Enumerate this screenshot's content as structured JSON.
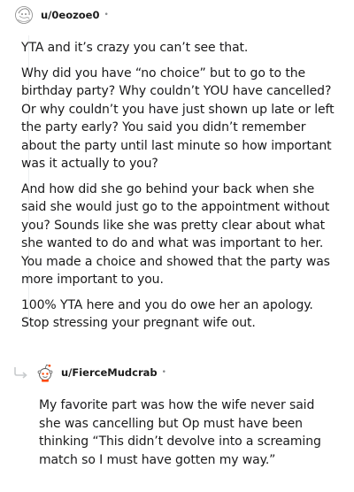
{
  "comments": [
    {
      "username": "u/0eozoe0",
      "dot": "•",
      "paragraphs": [
        "YTA and it’s crazy you can’t see that.",
        "Why did you have “no choice” but to go to the birthday party? Why couldn’t YOU have cancelled? Or why couldn’t you have just shown up late or left the party early? You said you didn’t remember about the party until last minute so how important was it actually to you?",
        "And how did she go behind your back when she said she would just go to the appointment without you? Sounds like she was pretty clear about what she wanted to do and what was important to her. You made a choice and showed that the party was more important to you.",
        "100% YTA here and you do owe her an apology. Stop stressing your pregnant wife out."
      ]
    },
    {
      "username": "u/FierceMudcrab",
      "dot": "•",
      "paragraphs": [
        "My favorite part was how the wife never said she was cancelling but Op must have been thinking “This didn’t devolve into a screaming match so I must have gotten my way.”"
      ]
    }
  ],
  "icons": {
    "avatar_1": "sketch-avatar-icon",
    "avatar_2": "snoo-avatar-icon",
    "reply": "reply-arrow-icon"
  }
}
